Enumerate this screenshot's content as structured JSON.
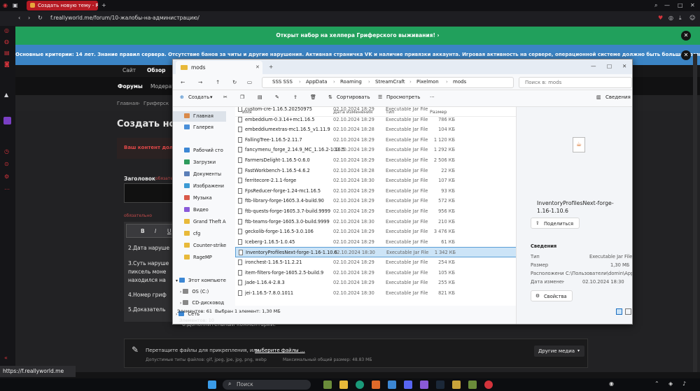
{
  "browser": {
    "tab_title": "Создать новую тему - Re",
    "url": "f.reallyworld.me/forum/10-жалобы-на-администрацию/",
    "hover_url": "https://f.reallyworld.me"
  },
  "forum": {
    "banner_green": "Открыт набор на хелпера Гриферского выживания!",
    "banner_blue": "Основные критерии: 14 лет. Знание правил сервера. Отсутствие банов за читы и другие нарушения. Активная страничка VK и наличие привязки аккаунта. Игровая активность на сервере, операционной системе должно быть больше месяца.",
    "nav_site": "Сайт",
    "nav_overview": "Обзор",
    "nav_forums": "Форумы",
    "nav_moderators": "Модерат",
    "breadcrumb_home": "Главная",
    "breadcrumb_griefer": "Гриферск",
    "page_title": "Создать нову",
    "warning": "Ваш контент долж",
    "field_title_label": "Заголовок",
    "field_title_required": "обязател",
    "field_required_small": "обязательно",
    "editor_buttons": [
      "B",
      "I",
      "U",
      "S"
    ],
    "lines": [
      "2.Дата наруше",
      "3.Суть наруше",
      "пиксель моне",
      "находился на",
      "4.Номер гриф",
      "5.Доказатель",
      "6.Дополнительный комментарий:"
    ],
    "attach_text": "Перетащите файлы для прикрепления, или",
    "attach_link": "выберите файлы ...",
    "attach_types": "Допустимые типы файлов: gif, jpeg, jpe, jpg, png, webp",
    "attach_max": "Максимальный общий размер: 48.83 МБ",
    "other_media": "Другие медиа"
  },
  "explorer": {
    "tab_title": "mods",
    "breadcrumbs": [
      "SSS SSS",
      "AppData",
      "Roaming",
      "StreamCraft",
      "Pixelmon",
      "mods"
    ],
    "search_placeholder": "Поиск в: mods",
    "toolbar": {
      "create": "Создать",
      "sort": "Сортировать",
      "view": "Просмотреть",
      "more": "···",
      "details": "Сведения"
    },
    "sidebar": [
      "Главная",
      "Галерея",
      "Рабочий сто",
      "Загрузки",
      "Документы",
      "Изображени",
      "Музыка",
      "Видео",
      "Grand Theft Aut",
      "cfg",
      "Counter-strike 2",
      "RageMP",
      "Этот компьютер",
      "OS (C:)",
      "CD-дисковод",
      "Сеть"
    ],
    "columns": [
      "Имя",
      "Дата изменения",
      "Тип",
      "Размер"
    ],
    "files": [
      {
        "name": "custom-cre-1.16.5.20250975",
        "date": "02.10.2024 18:29",
        "type": "Executable Jar File",
        "size": ""
      },
      {
        "name": "embeddium-0.3.14+mc1.16.5",
        "date": "02.10.2024 18:29",
        "type": "Executable Jar File",
        "size": "786 КБ"
      },
      {
        "name": "embeddiumextras-mc1.16.5_v1.11.9",
        "date": "02.10.2024 18:28",
        "type": "Executable Jar File",
        "size": "104 КБ"
      },
      {
        "name": "FallingTree-1.16.5-2.11.7",
        "date": "02.10.2024 18:29",
        "type": "Executable Jar File",
        "size": "1 120 КБ"
      },
      {
        "name": "fancymenu_forge_2.14.9_MC_1.16.2-1.16.5",
        "date": "02.10.2024 18:29",
        "type": "Executable Jar File",
        "size": "1 292 КБ"
      },
      {
        "name": "FarmersDelight-1.16.5-0.6.0",
        "date": "02.10.2024 18:29",
        "type": "Executable Jar File",
        "size": "2 506 КБ"
      },
      {
        "name": "FastWorkbench-1.16.5-4.6.2",
        "date": "02.10.2024 18:28",
        "type": "Executable Jar File",
        "size": "22 КБ"
      },
      {
        "name": "ferritecore-2.1.1-forge",
        "date": "02.10.2024 18:30",
        "type": "Executable Jar File",
        "size": "107 КБ"
      },
      {
        "name": "FpsReducer-forge-1.24-mc1.16.5",
        "date": "02.10.2024 18:29",
        "type": "Executable Jar File",
        "size": "93 КБ"
      },
      {
        "name": "ftb-library-forge-1605.3.4-build.90",
        "date": "02.10.2024 18:29",
        "type": "Executable Jar File",
        "size": "572 КБ"
      },
      {
        "name": "ftb-quests-forge-1605.3.7-build.9999",
        "date": "02.10.2024 18:29",
        "type": "Executable Jar File",
        "size": "956 КБ"
      },
      {
        "name": "ftb-teams-forge-1605.3.0-build.9999",
        "date": "02.10.2024 18:30",
        "type": "Executable Jar File",
        "size": "210 КБ"
      },
      {
        "name": "geckolib-forge-1.16.5-3.0.106",
        "date": "02.10.2024 18:29",
        "type": "Executable Jar File",
        "size": "3 476 КБ"
      },
      {
        "name": "Iceberg-1.16.5-1.0.45",
        "date": "02.10.2024 18:29",
        "type": "Executable Jar File",
        "size": "61 КБ"
      },
      {
        "name": "InventoryProfilesNext-forge-1.16-1.10.6",
        "date": "02.10.2024 18:30",
        "type": "Executable Jar File",
        "size": "1 342 КБ"
      },
      {
        "name": "ironchest-1.16.5-11.2.21",
        "date": "02.10.2024 18:29",
        "type": "Executable Jar File",
        "size": "254 КБ"
      },
      {
        "name": "item-filters-forge-1605.2.5-build.9",
        "date": "02.10.2024 18:29",
        "type": "Executable Jar File",
        "size": "105 КБ"
      },
      {
        "name": "Jade-1.16.4-2.8.3",
        "date": "02.10.2024 18:29",
        "type": "Executable Jar File",
        "size": "255 КБ"
      },
      {
        "name": "jei-1.16.5-7.8.0.1011",
        "date": "02.10.2024 18:30",
        "type": "Executable Jar File",
        "size": "821 КБ"
      }
    ],
    "selected_index": 14,
    "status_items": "Элементов: 61",
    "status_selected": "Выбран 1 элемент: 1,30 МБ",
    "status_below": "Элементов: 10",
    "preview": {
      "title": "InventoryProfilesNext-forge-1.16-1.10.6",
      "share": "Поделиться",
      "details_heading": "Сведения",
      "rows": [
        {
          "label": "Тип",
          "value": "Executable Jar File"
        },
        {
          "label": "Размер",
          "value": "1,30 МБ"
        },
        {
          "label": "Расположение",
          "value": "C:\\Пользователи\\domin\\App"
        },
        {
          "label": "Дата изменения",
          "value": "02.10.2024 18:30"
        }
      ],
      "properties": "Свойства"
    }
  },
  "taskbar": {
    "search": "Поиск"
  },
  "colors": {
    "accent_green": "#21a05c",
    "accent_blue": "#3b84c4",
    "opera_red": "#d3333b",
    "selection": "#cce4f7"
  }
}
